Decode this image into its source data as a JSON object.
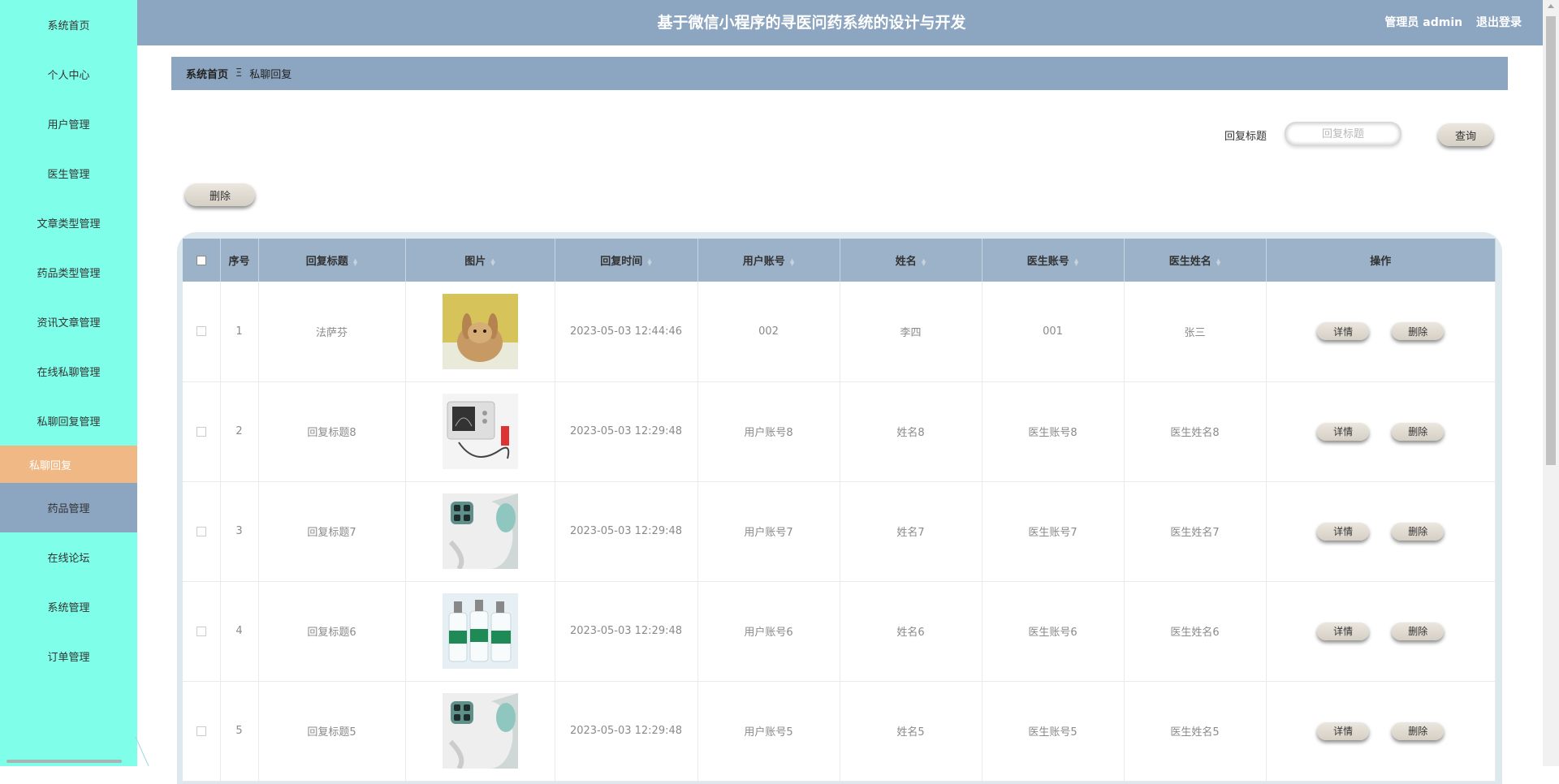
{
  "app": {
    "title": "基于微信小程序的寻医问药系统的设计与开发"
  },
  "user": {
    "role_name": "管理员 admin",
    "logout": "退出登录"
  },
  "sidebar": {
    "items": [
      {
        "label": "系统首页"
      },
      {
        "label": "个人中心"
      },
      {
        "label": "用户管理"
      },
      {
        "label": "医生管理"
      },
      {
        "label": "文章类型管理"
      },
      {
        "label": "药品类型管理"
      },
      {
        "label": "资讯文章管理"
      },
      {
        "label": "在线私聊管理"
      },
      {
        "label": "私聊回复管理"
      },
      {
        "label": "药品管理"
      },
      {
        "label": "在线论坛"
      },
      {
        "label": "系统管理"
      },
      {
        "label": "订单管理"
      }
    ],
    "sub_item": {
      "label": "私聊回复"
    }
  },
  "breadcrumb": {
    "home": "系统首页",
    "separator": "Ξ",
    "current": "私聊回复"
  },
  "search": {
    "label": "回复标题",
    "placeholder": "回复标题",
    "button": "查询"
  },
  "toolbar": {
    "delete_label": "删除"
  },
  "table": {
    "columns": [
      "序号",
      "回复标题",
      "图片",
      "回复时间",
      "用户账号",
      "姓名",
      "医生账号",
      "医生姓名",
      "操作"
    ],
    "detail_label": "详情",
    "delete_label": "删除",
    "rows": [
      {
        "index": "1",
        "title": "法萨芬",
        "image": "rabbit-photo",
        "time": "2023-05-03 12:44:46",
        "user_account": "002",
        "name": "李四",
        "doctor_account": "001",
        "doctor_name": "张三"
      },
      {
        "index": "2",
        "title": "回复标题8",
        "image": "ultrasound-device-photo",
        "time": "2023-05-03 12:29:48",
        "user_account": "用户账号8",
        "name": "姓名8",
        "doctor_account": "医生账号8",
        "doctor_name": "医生姓名8"
      },
      {
        "index": "3",
        "title": "回复标题7",
        "image": "massager-photo",
        "time": "2023-05-03 12:29:48",
        "user_account": "用户账号7",
        "name": "姓名7",
        "doctor_account": "医生账号7",
        "doctor_name": "医生姓名7"
      },
      {
        "index": "4",
        "title": "回复标题6",
        "image": "disinfectant-bottles-photo",
        "time": "2023-05-03 12:29:48",
        "user_account": "用户账号6",
        "name": "姓名6",
        "doctor_account": "医生账号6",
        "doctor_name": "医生姓名6"
      },
      {
        "index": "5",
        "title": "回复标题5",
        "image": "massager-photo",
        "time": "2023-05-03 12:29:48",
        "user_account": "用户账号5",
        "name": "姓名5",
        "doctor_account": "医生账号5",
        "doctor_name": "医生姓名5"
      }
    ]
  },
  "colors": {
    "sidebar_bg": "#7fffe9",
    "header_bg": "#8ca5c0",
    "active_sub_bg": "#f0b884",
    "table_header_bg": "#9cb2c8"
  }
}
